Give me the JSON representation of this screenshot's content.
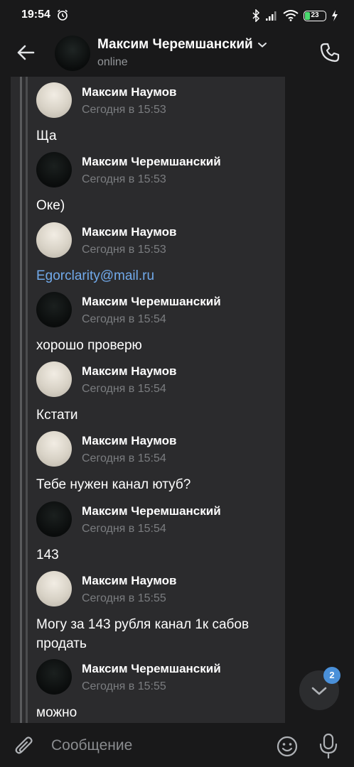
{
  "status_bar": {
    "time": "19:54",
    "battery": "23"
  },
  "header": {
    "title": "Максим Черемшанский",
    "status": "online"
  },
  "messages": [
    {
      "author": "Максим Наумов",
      "time": "Сегодня в 15:53",
      "text": "Ща",
      "avatar": "light"
    },
    {
      "author": "Максим Черемшанский",
      "time": "Сегодня в 15:53",
      "text": "Оке)",
      "avatar": "dark"
    },
    {
      "author": "Максим Наумов",
      "time": "Сегодня в 15:53",
      "text": "Egorclarity@mail.ru",
      "avatar": "light",
      "is_link": true
    },
    {
      "author": "Максим Черемшанский",
      "time": "Сегодня в 15:54",
      "text": "хорошо проверю",
      "avatar": "dark"
    },
    {
      "author": "Максим Наумов",
      "time": "Сегодня в 15:54",
      "text": "Кстати",
      "avatar": "light"
    },
    {
      "author": "Максим Наумов",
      "time": "Сегодня в 15:54",
      "text": "Тебе нужен канал ютуб?",
      "avatar": "light"
    },
    {
      "author": "Максим Черемшанский",
      "time": "Сегодня в 15:54",
      "text": "143",
      "avatar": "dark"
    },
    {
      "author": "Максим Наумов",
      "time": "Сегодня в 15:55",
      "text": "Могу за 143 рубля канал 1к сабов продать",
      "avatar": "light"
    },
    {
      "author": "Максим Черемшанский",
      "time": "Сегодня в 15:55",
      "text": "можно",
      "avatar": "dark"
    }
  ],
  "unread_badge": "2",
  "composer": {
    "placeholder": "Сообщение"
  },
  "colors": {
    "background": "#19191a",
    "panel": "#2b2b2d",
    "link": "#71aaeb",
    "badge": "#4a90d9",
    "battery": "#4bd96f"
  },
  "icons": [
    "alarm-icon",
    "bluetooth-icon",
    "signal-icon",
    "wifi-icon",
    "battery-icon",
    "charging-icon",
    "back-arrow-icon",
    "chevron-down-icon",
    "phone-icon",
    "scroll-down-icon",
    "attach-icon",
    "emoji-icon",
    "microphone-icon"
  ]
}
